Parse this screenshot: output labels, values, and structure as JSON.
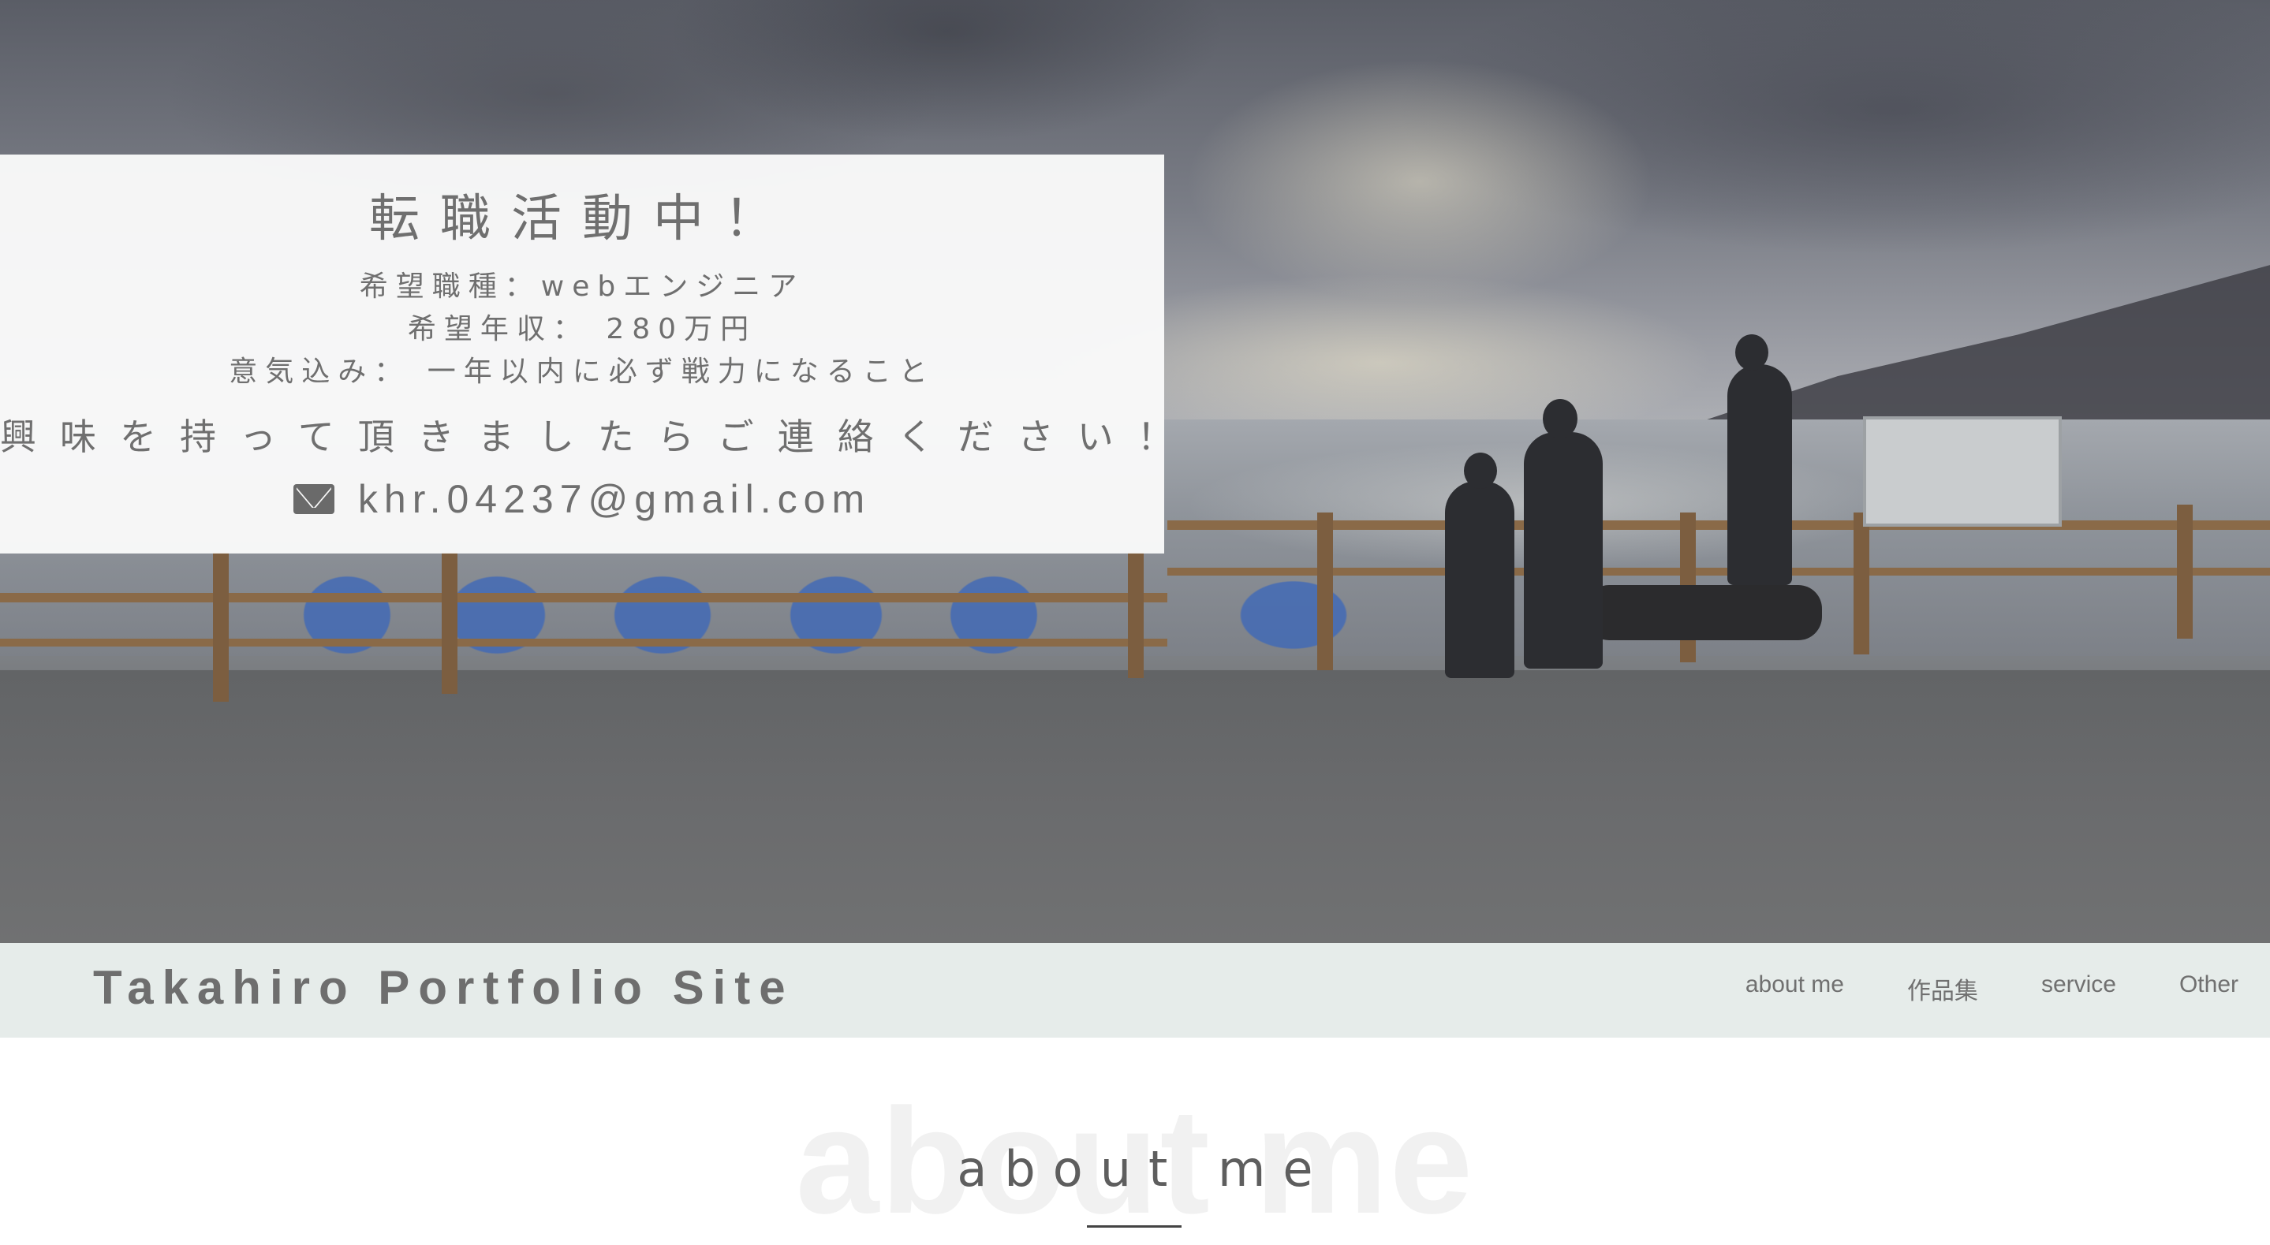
{
  "hero": {
    "card": {
      "title": "転職活動中！",
      "lines": [
        "希望職種：webエンジニア",
        "希望年収： 280万円",
        "意気込み： 一年以内に必ず戦力になること"
      ],
      "call_to_action": "興味を持って頂きましたらご連絡ください！",
      "email_icon": "envelope-icon",
      "email": "khr.04237@gmail.com"
    }
  },
  "navbar": {
    "site_title": "Takahiro Portfolio Site",
    "links": [
      "about me",
      "作品集",
      "service",
      "Other"
    ],
    "background": "#e6ecea"
  },
  "about": {
    "watermark": "about me",
    "heading": "about me"
  }
}
